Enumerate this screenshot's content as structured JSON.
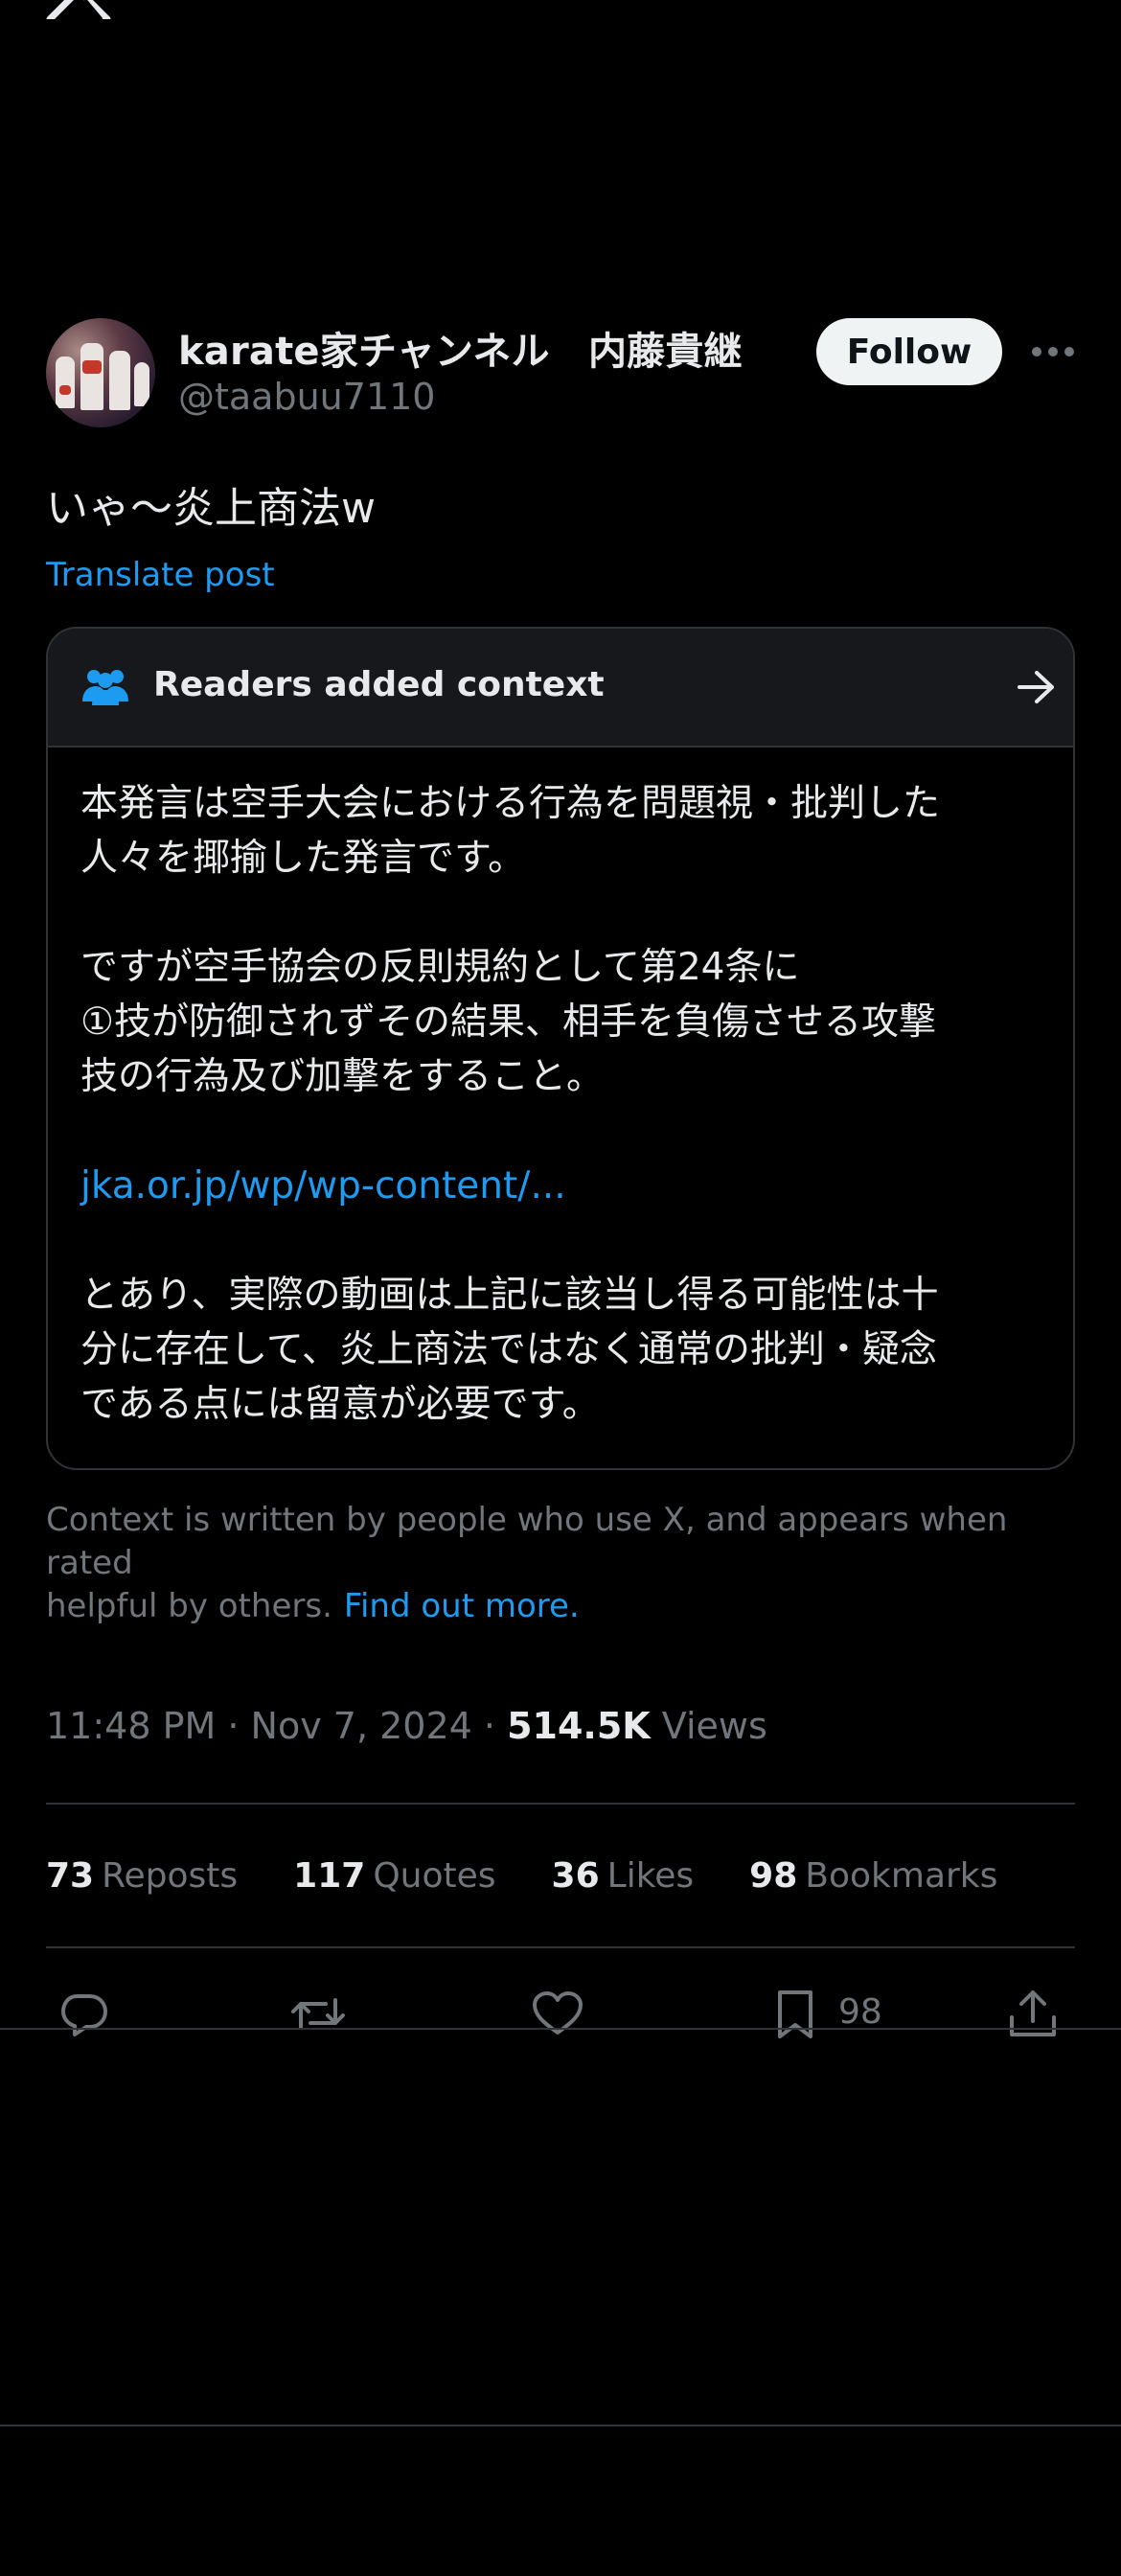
{
  "icons": {
    "logo": "x-logo-icon",
    "more": "more-horizontal-icon",
    "people": "people-icon",
    "arrow": "arrow-right-icon",
    "reply": "reply-icon",
    "repost": "repost-icon",
    "like": "heart-icon",
    "bookmark": "bookmark-icon",
    "share": "share-icon"
  },
  "colors": {
    "background": "#000000",
    "text": "#e7e9ea",
    "secondary": "#71767b",
    "link": "#1d9bf0",
    "border": "#2f3336"
  },
  "post": {
    "author_name": "karate家チャンネル　内藤貴継",
    "handle": "@taabuu7110",
    "follow_label": "Follow",
    "text": "いゃ〜炎上商法w",
    "translate_label": "Translate post",
    "timestamp": "11:48 PM · Nov 7, 2024 · ",
    "views_count": "514.5K",
    "views_label": " Views"
  },
  "note": {
    "title": "Readers added context",
    "lines_1": [
      "本発言は空手大会における行為を問題視・批判した",
      "人々を揶揄した発言です。"
    ],
    "lines_2": [
      "ですが空手協会の反則規約として第24条に",
      "①技が防御されずその結果、相手を負傷させる攻撃",
      "技の行為及び加撃をすること。"
    ],
    "link": "jka.or.jp/wp/wp-content/...",
    "lines_3": [
      "とあり、実際の動画は上記に該当し得る可能性は十",
      "分に存在して、炎上商法ではなく通常の批判・疑念",
      "である点には留意が必要です。"
    ]
  },
  "context_info": {
    "line1": "Context is written by people who use X, and appears when rated",
    "line2": "helpful by others.",
    "find_out": "Find out more."
  },
  "stats": [
    {
      "count": "73",
      "label": "Reposts"
    },
    {
      "count": "117",
      "label": "Quotes"
    },
    {
      "count": "36",
      "label": "Likes"
    },
    {
      "count": "98",
      "label": "Bookmarks"
    }
  ],
  "actions": {
    "bookmark_count": "98"
  }
}
